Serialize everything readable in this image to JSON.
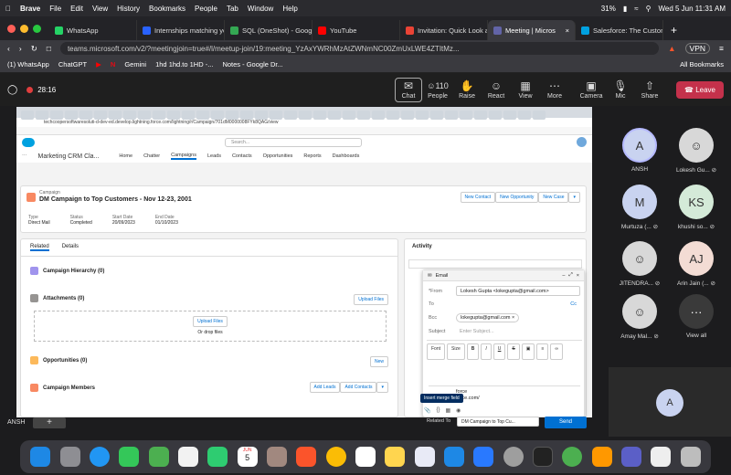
{
  "menubar": {
    "app": "Brave",
    "items": [
      "File",
      "Edit",
      "View",
      "History",
      "Bookmarks",
      "People",
      "Tab",
      "Window",
      "Help"
    ],
    "battery": "31%",
    "clock": "Wed 5 Jun  11:31 AM"
  },
  "tabs": [
    {
      "label": "WhatsApp",
      "color": "#25d366"
    },
    {
      "label": "Internships matching yo",
      "color": "#2962ff"
    },
    {
      "label": "SQL (OneShot) - Googl",
      "color": "#34a853"
    },
    {
      "label": "YouTube",
      "color": "#ff0000"
    },
    {
      "label": "Invitation: Quick Look a",
      "color": "#ea4335"
    },
    {
      "label": "Meeting | Micros",
      "color": "#6264a7"
    },
    {
      "label": "Salesforce: The Custom",
      "color": "#00a1e0"
    }
  ],
  "address": {
    "url": "teams.microsoft.com/v2/?meetingjoin=true#/l/meetup-join/19:meeting_YzAxYWRhMzAtZWNmNC00ZmUxLWE4ZTItMz...",
    "vpn": "VPN"
  },
  "bookmarks": [
    "(1) WhatsApp",
    "ChatGPT",
    "Gemini",
    "1hd 1hd.to 1HD -...",
    "Notes - Google Dr..."
  ],
  "all_bookmarks": "All Bookmarks",
  "teams": {
    "timer": "28:16",
    "chat": "Chat",
    "people_count": "110",
    "people": "People",
    "raise": "Raise",
    "react": "React",
    "view": "View",
    "more": "More",
    "camera": "Camera",
    "mic": "Mic",
    "share": "Share",
    "leave": "Leave"
  },
  "sf": {
    "url": "techcoopersoftwaresoluti-d-dev-ed.develop.lightning.force.com/lightning/r/Campaign/701dM0000008FYk8QAG/view",
    "search_placeholder": "Search...",
    "app": "Marketing CRM Cla...",
    "nav": [
      "Home",
      "Chatter",
      "Campaigns",
      "Leads",
      "Contacts",
      "Opportunities",
      "Reports",
      "Dashboards"
    ],
    "record_type": "Campaign",
    "record_title": "DM Campaign to Top Customers - Nov 12-23, 2001",
    "actions": [
      "New Contact",
      "New Opportunity",
      "New Case"
    ],
    "fields": [
      {
        "label": "Type",
        "value": "Direct Mail"
      },
      {
        "label": "Status",
        "value": "Completed"
      },
      {
        "label": "Start Date",
        "value": "20/09/2023"
      },
      {
        "label": "End Date",
        "value": "01/10/2023"
      }
    ],
    "tab_related": "Related",
    "tab_details": "Details",
    "hierarchy": "Campaign Hierarchy (0)",
    "attachments": "Attachments (0)",
    "upload_files": "Upload Files",
    "or_drop": "Or drop files",
    "opportunities": "Opportunities (0)",
    "new": "New",
    "members": "Campaign Members",
    "add_leads": "Add Leads",
    "add_contacts": "Add Contacts",
    "activity": "Activity",
    "email": {
      "title": "Email",
      "from_label": "*From",
      "from": "Lokesh Gupta <lokegupta@gmail.com>",
      "to": "To",
      "cc": "Cc",
      "bcc_label": "Bcc",
      "bcc": "lokegupta@gmail.com",
      "subject_label": "Subject",
      "subject_placeholder": "Enter Subject...",
      "font": "Font",
      "size": "Size",
      "sig1": "force",
      "sig2": "force.com/",
      "tooltip": "Insert merge field",
      "related_label": "Related To",
      "related": "DM Campaign to Top Cu...",
      "send": "Send"
    }
  },
  "participants": [
    {
      "initials": "A",
      "name": "ANSH",
      "bg": "#c9d3f0"
    },
    {
      "initials": "",
      "name": "Lokesh Gu...",
      "bg": "#d8d8d8"
    },
    {
      "initials": "M",
      "name": "Murtuza (...",
      "bg": "#c9d3f0"
    },
    {
      "initials": "KS",
      "name": "khushi so...",
      "bg": "#d4ead8"
    },
    {
      "initials": "",
      "name": "JITENDRA...",
      "bg": "#d8d8d8"
    },
    {
      "initials": "AJ",
      "name": "Arin Jain (...",
      "bg": "#f3dcd4"
    },
    {
      "initials": "",
      "name": "Amay Mal...",
      "bg": "#d8d8d8"
    },
    {
      "initials": "···",
      "name": "View all",
      "bg": "#3a3a3a"
    }
  ],
  "self": {
    "initials": "A",
    "label": "ANSH"
  },
  "dock_calendar": {
    "month": "JUN",
    "day": "5"
  }
}
